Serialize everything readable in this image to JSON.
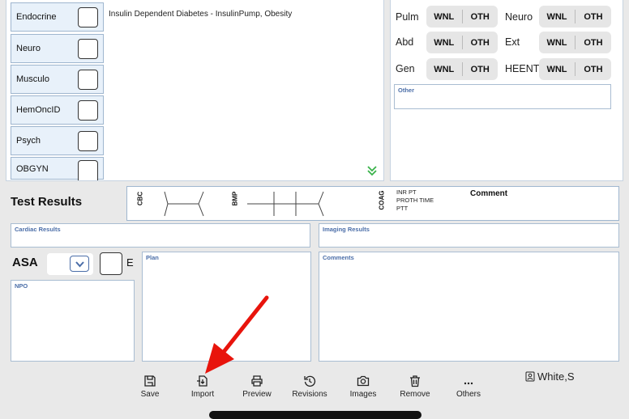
{
  "systems": [
    {
      "label": "Endocrine"
    },
    {
      "label": "Neuro"
    },
    {
      "label": "Musculo"
    },
    {
      "label": "HemOncID"
    },
    {
      "label": "Psych"
    },
    {
      "label": "OBGYN"
    }
  ],
  "history_text": "Insulin Dependent Diabetes - InsulinPump, Obesity",
  "exam": {
    "rows": [
      {
        "left": "Pulm",
        "right": "Neuro"
      },
      {
        "left": "Abd",
        "right": "Ext"
      },
      {
        "left": "Gen",
        "right": "HEENT"
      }
    ],
    "wnl": "WNL",
    "oth": "OTH",
    "other_label": "Other"
  },
  "tests": {
    "title": "Test Results",
    "cbc": "CBC",
    "bmp": "BMP",
    "coag": "COAG",
    "coag_items": [
      "INR PT",
      "PROTH TIME",
      "PTT"
    ],
    "comment": "Comment"
  },
  "cardiac_label": "Cardiac Results",
  "imaging_label": "Imaging Results",
  "asa": {
    "label": "ASA",
    "e_label": "E"
  },
  "plan_label": "Plan",
  "comments_label": "Comments",
  "npo_label": "NPO",
  "toolbar": {
    "items": [
      {
        "label": "Save",
        "icon": "save-icon"
      },
      {
        "label": "Import",
        "icon": "import-icon"
      },
      {
        "label": "Preview",
        "icon": "printer-icon"
      },
      {
        "label": "Revisions",
        "icon": "history-icon"
      },
      {
        "label": "Images",
        "icon": "camera-icon"
      },
      {
        "label": "Remove",
        "icon": "trash-icon"
      },
      {
        "label": "Others",
        "icon": "ellipsis-icon"
      }
    ],
    "user": "White,S"
  },
  "colors": {
    "accent": "#4b6ea8",
    "arrow": "#e8140c",
    "button_bg": "#e8f1fa"
  }
}
